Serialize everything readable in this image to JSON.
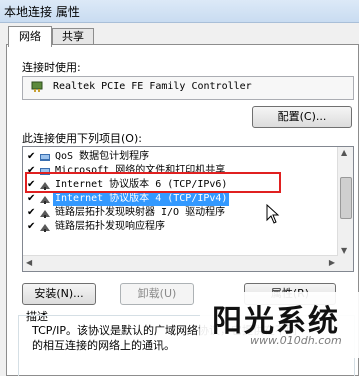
{
  "window": {
    "title": "本地连接 属性"
  },
  "tabs": [
    {
      "label": "网络",
      "active": true
    },
    {
      "label": "共享",
      "active": false
    }
  ],
  "connect_using": {
    "label": "连接时使用:",
    "adapter": "Realtek PCIe FE Family Controller",
    "configure_button": "配置(C)..."
  },
  "items_section": {
    "label": "此连接使用下列项目(O):",
    "items": [
      {
        "text": "QoS 数据包计划程序",
        "checked": true,
        "icon": "network-service-icon"
      },
      {
        "text": "Microsoft 网络的文件和打印机共享",
        "checked": true,
        "icon": "network-service-icon"
      },
      {
        "text": "Internet 协议版本 6 (TCP/IPv6)",
        "checked": true,
        "icon": "protocol-icon"
      },
      {
        "text": "Internet 协议版本 4 (TCP/IPv4)",
        "checked": true,
        "icon": "protocol-icon",
        "selected": true
      },
      {
        "text": "链路层拓扑发现映射器 I/O 驱动程序",
        "checked": true,
        "icon": "protocol-icon"
      },
      {
        "text": "链路层拓扑发现响应程序",
        "checked": true,
        "icon": "protocol-icon"
      }
    ]
  },
  "buttons": {
    "install": "安装(N)...",
    "uninstall": "卸载(U)",
    "properties": "属性(R)"
  },
  "description": {
    "label": "描述",
    "line1": "TCP/IP。该协议是默认的广域网络协议，它提供在不同",
    "line2": "的相互连接的网络上的通讯。"
  },
  "watermark": {
    "title": "阳光系统",
    "url": "www.010dh.com"
  },
  "colors": {
    "selection": "#3399ff",
    "highlight_box": "#e02020"
  }
}
